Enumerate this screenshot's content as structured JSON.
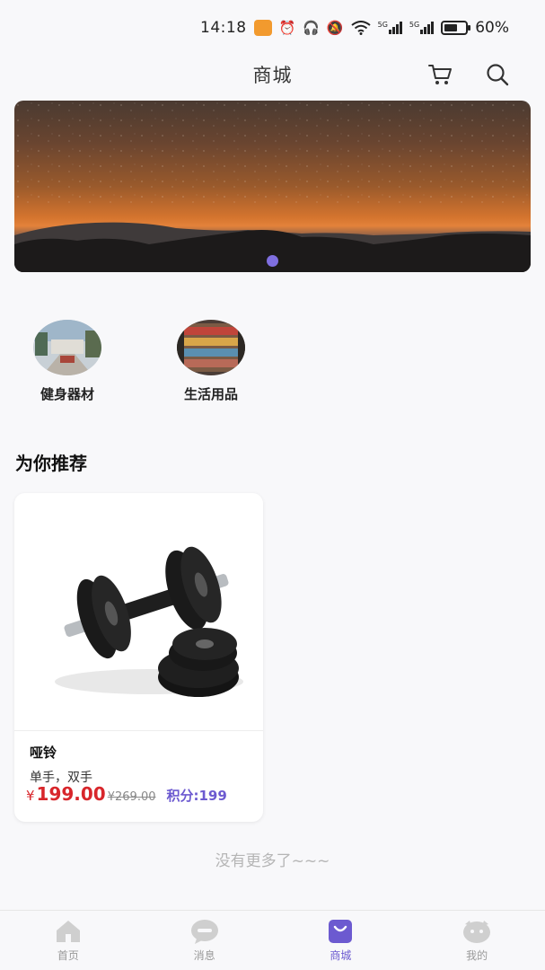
{
  "status_bar": {
    "time": "14:18",
    "signal_1": "5G",
    "signal_2": "5G",
    "battery": "60%"
  },
  "header": {
    "title": "商城",
    "cart_icon": "cart-icon",
    "search_icon": "search-icon"
  },
  "banner": {
    "dot_count": 1,
    "active_dot": 1
  },
  "categories": [
    {
      "label": "健身器材"
    },
    {
      "label": "生活用品"
    }
  ],
  "recommend": {
    "title": "为你推荐",
    "products": [
      {
        "name": "哑铃",
        "desc": "单手，双手",
        "currency": "¥",
        "price": "199.00",
        "original_price": "¥269.00",
        "points": "积分:199"
      }
    ],
    "no_more": "没有更多了~~~"
  },
  "tabs": [
    {
      "label": "首页",
      "icon": "home-icon",
      "active": false
    },
    {
      "label": "消息",
      "icon": "message-icon",
      "active": false
    },
    {
      "label": "商城",
      "icon": "shop-bag-icon",
      "active": true
    },
    {
      "label": "我的",
      "icon": "profile-icon",
      "active": false
    }
  ],
  "colors": {
    "accent": "#6c5ad0",
    "price": "#d8262b",
    "tab_inactive": "#999999"
  }
}
